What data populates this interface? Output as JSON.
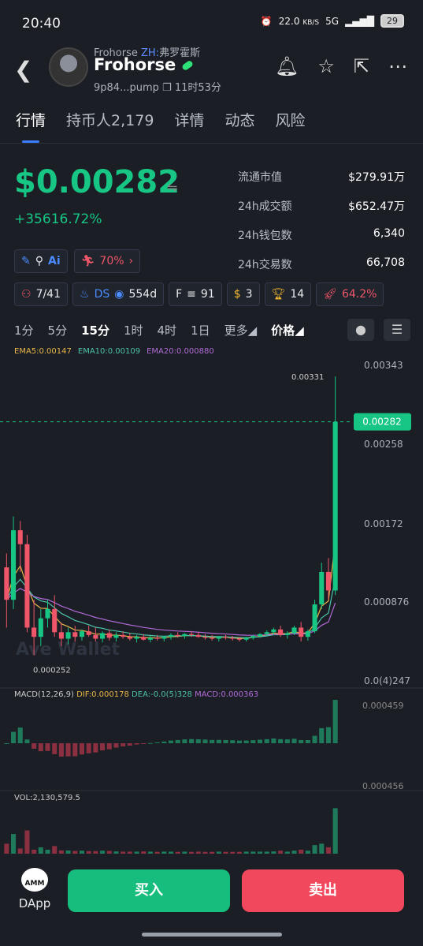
{
  "status": {
    "time": "20:40",
    "speed": "22.0",
    "speed_unit": "KB/S",
    "network": "5G",
    "battery": "29"
  },
  "header": {
    "sub_name": "Frohorse",
    "sub_zh_label": "ZH:",
    "sub_zh_name": "弗罗霍斯",
    "name": "Frohorse",
    "address": "9p84...pump",
    "age": "11时53分"
  },
  "tabs": [
    {
      "label": "行情"
    },
    {
      "label": "持币人2,179"
    },
    {
      "label": "详情"
    },
    {
      "label": "动态"
    },
    {
      "label": "风险"
    }
  ],
  "price": {
    "value": "$0.00282",
    "change": "+35616.72%"
  },
  "stats": [
    {
      "k": "流通市值",
      "v": "$279.91万"
    },
    {
      "k": "24h成交额",
      "v": "$652.47万"
    },
    {
      "k": "24h钱包数",
      "v": "6,340"
    },
    {
      "k": "24h交易数",
      "v": "66,708"
    }
  ],
  "badges": {
    "ai": "Ai",
    "runner": "70%",
    "kol": "7/41",
    "ds": "DS",
    "ds_days": "554d",
    "f_label": "F",
    "f_count": "91",
    "money": "3",
    "trophy": "14",
    "rocket": "64.2%"
  },
  "timeframes": [
    {
      "label": "1分"
    },
    {
      "label": "5分"
    },
    {
      "label": "15分"
    },
    {
      "label": "1时"
    },
    {
      "label": "4时"
    },
    {
      "label": "1日"
    },
    {
      "label": "更多"
    },
    {
      "label": "价格"
    }
  ],
  "ema": {
    "ema5": "EMA5:0.00147",
    "ema10": "EMA10:0.00109",
    "ema20": "EMA20:0.000880"
  },
  "chart_data": {
    "type": "candlestick",
    "interval": "15分",
    "price_axis_labels": [
      "0.00343",
      "0.00258",
      "0.00172",
      "0.000876",
      "0.0(4)247"
    ],
    "current_price_label": "0.00282",
    "high_marker": "0.00331",
    "low_marker": "0.000252",
    "macd_label": "MACD(12,26,9)",
    "dif": "DIF:0.000178",
    "dea": "DEA:-0.0(5)328",
    "macd": "MACD:0.000363",
    "macd_axis": [
      "0.000459",
      "0.000456"
    ],
    "vol_label": "VOL:2,130,579.5",
    "watermark": "Ave Wallet",
    "candles": [
      [
        0.00125,
        0.0014,
        0.0006,
        0.0009
      ],
      [
        0.0009,
        0.0018,
        0.0008,
        0.00165
      ],
      [
        0.00165,
        0.00175,
        0.0012,
        0.0015
      ],
      [
        0.0015,
        0.0016,
        0.00055,
        0.0006
      ],
      [
        0.0006,
        0.0009,
        0.0003,
        0.0005
      ],
      [
        0.0005,
        0.0008,
        0.0004,
        0.0007
      ],
      [
        0.0007,
        0.0009,
        0.0006,
        0.0008
      ],
      [
        0.0008,
        0.00095,
        0.0005,
        0.00055
      ],
      [
        0.00055,
        0.00065,
        0.0004,
        0.00048
      ],
      [
        0.00048,
        0.0006,
        0.00042,
        0.00055
      ],
      [
        0.00055,
        0.00062,
        0.00045,
        0.0005
      ],
      [
        0.0005,
        0.00058,
        0.00046,
        0.00056
      ],
      [
        0.00056,
        0.00062,
        0.0005,
        0.00052
      ],
      [
        0.00052,
        0.0006,
        0.00045,
        0.00048
      ],
      [
        0.00048,
        0.00056,
        0.00044,
        0.00054
      ],
      [
        0.00054,
        0.00058,
        0.00046,
        0.00049
      ],
      [
        0.00049,
        0.00055,
        0.00045,
        0.00052
      ],
      [
        0.00052,
        0.00056,
        0.00048,
        0.0005
      ],
      [
        0.0005,
        0.00054,
        0.00046,
        0.00048
      ],
      [
        0.00048,
        0.00052,
        0.00044,
        0.0005
      ],
      [
        0.0005,
        0.00053,
        0.00046,
        0.00047
      ],
      [
        0.00047,
        0.00051,
        0.00044,
        0.00049
      ],
      [
        0.00049,
        0.00052,
        0.00046,
        0.00048
      ],
      [
        0.00048,
        0.00051,
        0.00045,
        0.0005
      ],
      [
        0.0005,
        0.00054,
        0.00047,
        0.00052
      ],
      [
        0.00052,
        0.00055,
        0.00049,
        0.00051
      ],
      [
        0.00051,
        0.00054,
        0.00048,
        0.00053
      ],
      [
        0.00053,
        0.00056,
        0.0005,
        0.00052
      ],
      [
        0.00052,
        0.00055,
        0.00049,
        0.0005
      ],
      [
        0.0005,
        0.00053,
        0.00047,
        0.00049
      ],
      [
        0.00049,
        0.00052,
        0.00046,
        0.00048
      ],
      [
        0.00048,
        0.00051,
        0.00045,
        0.0005
      ],
      [
        0.0005,
        0.00052,
        0.00047,
        0.00049
      ],
      [
        0.00049,
        0.00051,
        0.00046,
        0.00048
      ],
      [
        0.00048,
        0.0005,
        0.00045,
        0.00047
      ],
      [
        0.00047,
        0.0005,
        0.00045,
        0.00049
      ],
      [
        0.00049,
        0.00052,
        0.00047,
        0.00051
      ],
      [
        0.00051,
        0.00054,
        0.00049,
        0.00053
      ],
      [
        0.00053,
        0.00057,
        0.00051,
        0.00055
      ],
      [
        0.00055,
        0.0006,
        0.00052,
        0.00058
      ],
      [
        0.00058,
        0.00062,
        0.0005,
        0.00052
      ],
      [
        0.00052,
        0.00056,
        0.00048,
        0.00054
      ],
      [
        0.00054,
        0.00062,
        0.00052,
        0.0006
      ],
      [
        0.0006,
        0.00066,
        0.00045,
        0.0005
      ],
      [
        0.0005,
        0.00058,
        0.00046,
        0.00056
      ],
      [
        0.00056,
        0.0009,
        0.00054,
        0.00085
      ],
      [
        0.00085,
        0.0013,
        0.0008,
        0.0012
      ],
      [
        0.0012,
        0.00135,
        0.0009,
        0.001
      ],
      [
        0.001,
        0.00331,
        0.00095,
        0.00282
      ]
    ]
  },
  "bottom": {
    "dapp": "DApp",
    "amm": "AMM",
    "buy": "买入",
    "sell": "卖出"
  },
  "colors": {
    "up": "#17c684",
    "down": "#f0566a",
    "ema5": "#e9b64a",
    "ema10": "#4cc3a8",
    "ema20": "#b06ad8"
  }
}
